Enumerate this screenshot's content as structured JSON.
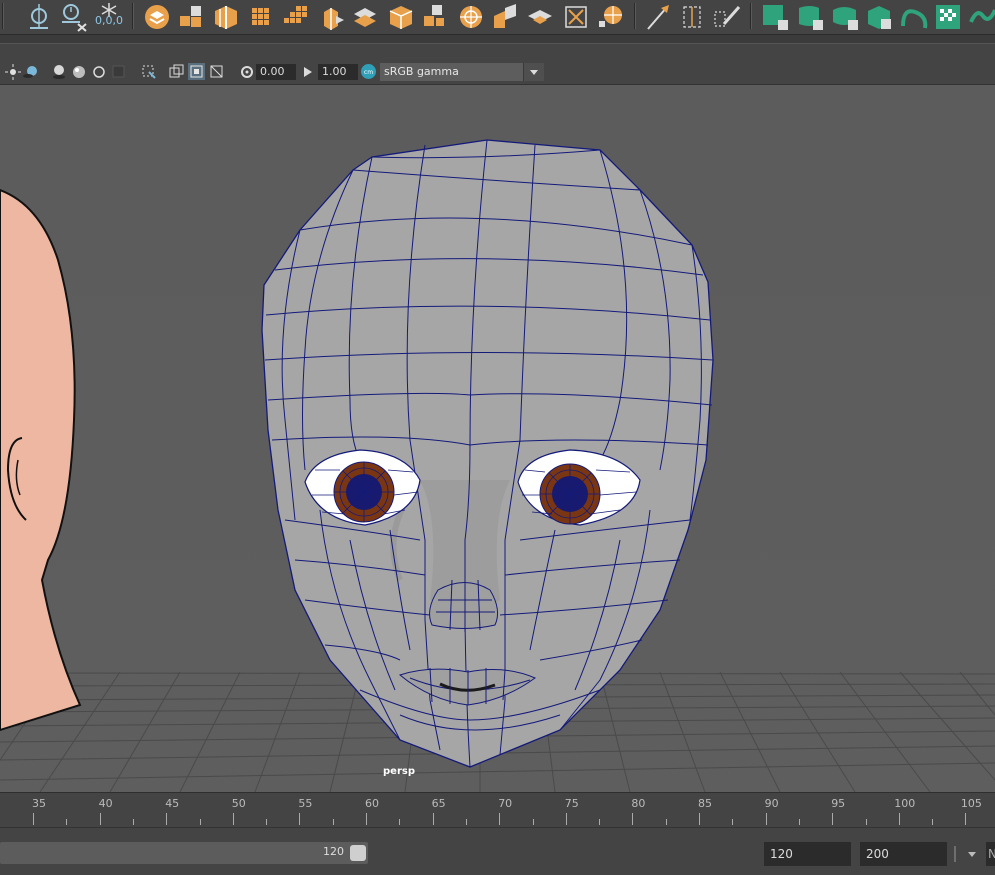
{
  "shelf": {
    "icons": [
      "camera-icon",
      "clock-icon",
      "snowflake-icon",
      "layer-icon",
      "cubes-icon",
      "cube-split-icon",
      "grid-icon",
      "grid-cube-icon",
      "box-icon",
      "diamond-icon",
      "crate-icon",
      "puzzle-icon",
      "wheel-icon",
      "folded-box-icon",
      "flat-diamond-icon",
      "frame-icon",
      "globe-icon",
      "knife-icon",
      "bounding-box-icon",
      "pencil-icon",
      "green-square-icon",
      "green-cylinder-icon",
      "green-box-icon",
      "green-cube-icon",
      "green-curve-icon",
      "checker-icon",
      "crop-icon"
    ],
    "origin_label": "0,0,0"
  },
  "viewport_toolbar": {
    "exposure_value": "0.00",
    "gamma_value": "1.00",
    "color_space": "sRGB gamma"
  },
  "viewport": {
    "camera_label": "persp",
    "colors": {
      "background": "#5d5d5d",
      "grid": "#4a4a4a",
      "mesh_surface": "#a6a6a6",
      "wireframe": "#141a7a",
      "iris": "#7a3612",
      "skin_reference": "#eeb7a2"
    }
  },
  "timeline": {
    "ticks": [
      "35",
      "40",
      "45",
      "50",
      "55",
      "60",
      "65",
      "70",
      "75",
      "80",
      "85",
      "90",
      "95",
      "100",
      "105"
    ]
  },
  "range": {
    "slider_end_value": "120",
    "end_time": "120",
    "anim_end": "200",
    "extra_label": "N"
  }
}
